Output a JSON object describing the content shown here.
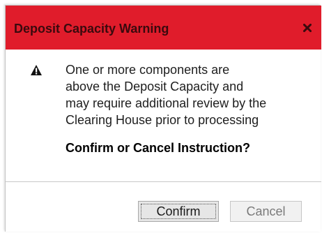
{
  "dialog": {
    "title": "Deposit Capacity Warning",
    "close_icon": "close-icon",
    "warning_icon": "warning-triangle-icon",
    "message_lines": [
      "One or more components are",
      "above the Deposit Capacity and",
      "may require additional review by the",
      "Clearing House prior to processing"
    ],
    "question": "Confirm or Cancel Instruction?",
    "confirm_label": "Confirm",
    "cancel_label": "Cancel",
    "accent_color": "#e01c2b"
  }
}
